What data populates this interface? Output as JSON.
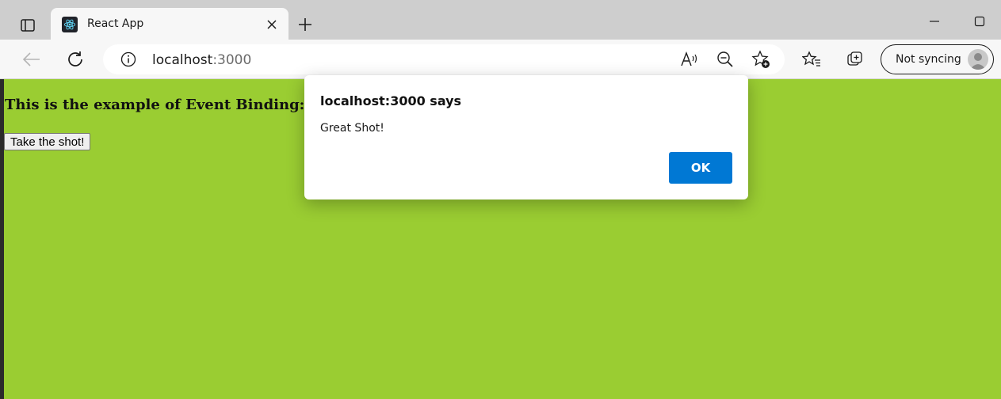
{
  "tab": {
    "title": "React App",
    "favicon": "react-logo-icon"
  },
  "address": {
    "host": "localhost",
    "port": ":3000"
  },
  "profile": {
    "sync_label": "Not syncing"
  },
  "page": {
    "background": "#9acd32",
    "heading": "This is the example of Event Binding:",
    "button_label": "Take the shot!"
  },
  "dialog": {
    "title": "localhost:3000 says",
    "message": "Great Shot!",
    "ok_label": "OK",
    "ok_color": "#0078d4"
  }
}
